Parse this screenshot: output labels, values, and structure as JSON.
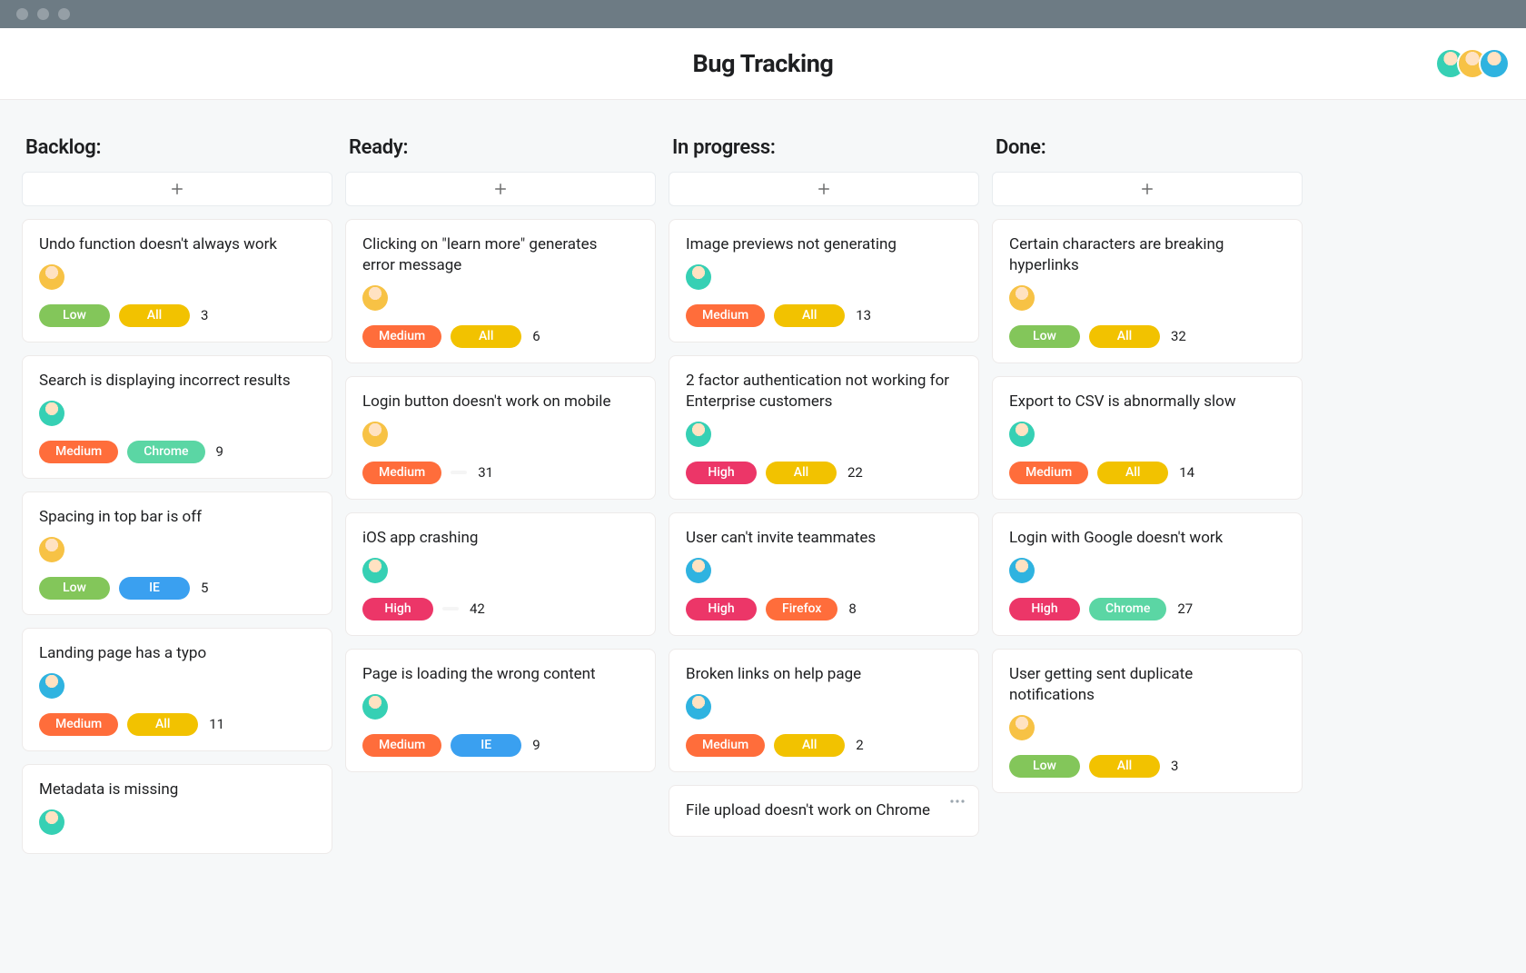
{
  "window": {
    "traffic_dots": 3
  },
  "header": {
    "title": "Bug Tracking",
    "members": [
      "b",
      "a",
      "c"
    ]
  },
  "pill_classes": {
    "priority": {
      "Low": "p-low",
      "Medium": "p-medium",
      "High": "p-high"
    },
    "browser": {
      "All": "b-all",
      "Chrome": "b-chrome",
      "Firefox": "b-firefox",
      "IE": "b-ie",
      "": "b-blank"
    }
  },
  "avatar_classes": {
    "a": "av-a",
    "b": "av-b",
    "c": "av-c"
  },
  "columns": [
    {
      "id": "backlog",
      "title": "Backlog:",
      "cards": [
        {
          "title": "Undo function doesn't always work",
          "assignee": "a",
          "priority": "Low",
          "browser": "All",
          "count": 3
        },
        {
          "title": "Search is displaying incorrect results",
          "assignee": "b",
          "priority": "Medium",
          "browser": "Chrome",
          "count": 9
        },
        {
          "title": "Spacing in top bar is off",
          "assignee": "a",
          "priority": "Low",
          "browser": "IE",
          "count": 5
        },
        {
          "title": "Landing page has a typo",
          "assignee": "c",
          "priority": "Medium",
          "browser": "All",
          "count": 11
        },
        {
          "title": "Metadata is missing",
          "assignee": "b"
        }
      ]
    },
    {
      "id": "ready",
      "title": "Ready:",
      "cards": [
        {
          "title": "Clicking on \"learn more\" generates error message",
          "assignee": "a",
          "priority": "Medium",
          "browser": "All",
          "count": 6
        },
        {
          "title": "Login button doesn't work on mobile",
          "assignee": "a",
          "priority": "Medium",
          "browser": "",
          "count": 31
        },
        {
          "title": "iOS app crashing",
          "assignee": "b",
          "priority": "High",
          "browser": "",
          "count": 42
        },
        {
          "title": "Page is loading the wrong content",
          "assignee": "b",
          "priority": "Medium",
          "browser": "IE",
          "count": 9
        }
      ]
    },
    {
      "id": "inprogress",
      "title": "In progress:",
      "cards": [
        {
          "title": "Image previews not generating",
          "assignee": "b",
          "priority": "Medium",
          "browser": "All",
          "count": 13
        },
        {
          "title": "2 factor authentication not working for Enterprise customers",
          "assignee": "b",
          "priority": "High",
          "browser": "All",
          "count": 22
        },
        {
          "title": "User can't invite teammates",
          "assignee": "c",
          "priority": "High",
          "browser": "Firefox",
          "count": 8
        },
        {
          "title": "Broken links on help page",
          "assignee": "c",
          "priority": "Medium",
          "browser": "All",
          "count": 2
        },
        {
          "title": "File upload doesn't work on Chrome",
          "show_menu": true
        }
      ]
    },
    {
      "id": "done",
      "title": "Done:",
      "cards": [
        {
          "title": "Certain characters are breaking hyperlinks",
          "assignee": "a",
          "priority": "Low",
          "browser": "All",
          "count": 32
        },
        {
          "title": "Export to CSV is abnormally slow",
          "assignee": "b",
          "priority": "Medium",
          "browser": "All",
          "count": 14
        },
        {
          "title": "Login with Google doesn't work",
          "assignee": "c",
          "priority": "High",
          "browser": "Chrome",
          "count": 27
        },
        {
          "title": "User getting sent duplicate notifications",
          "assignee": "a",
          "priority": "Low",
          "browser": "All",
          "count": 3
        }
      ]
    }
  ]
}
